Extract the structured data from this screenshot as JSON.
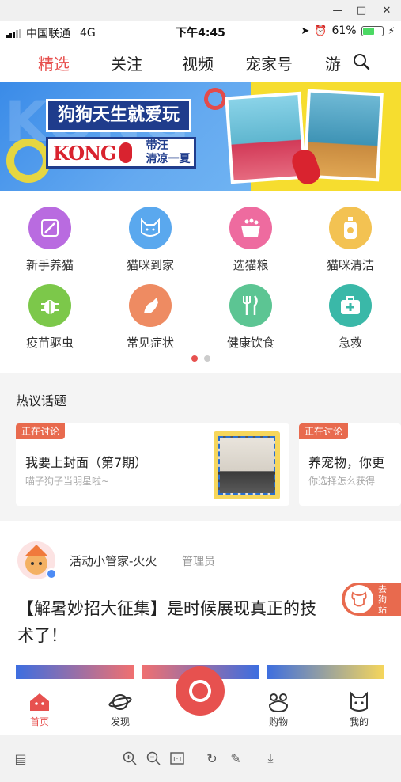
{
  "status": {
    "carrier": "中国联通",
    "network": "4G",
    "time": "下午4:45",
    "battery": "61%"
  },
  "nav": {
    "tabs": [
      "精选",
      "关注",
      "视频",
      "宠家号",
      "游"
    ],
    "active_index": 0
  },
  "banner": {
    "headline": "狗狗天生就爱玩",
    "brand": "KONG",
    "slogan_1": "带汪",
    "slogan_2": "清凉一夏",
    "bg_text": "KONG"
  },
  "categories": [
    {
      "label": "新手养猫",
      "icon": "pencil-icon",
      "color": "#b96be0"
    },
    {
      "label": "猫咪到家",
      "icon": "cat-face-icon",
      "color": "#5aa8ee"
    },
    {
      "label": "选猫粮",
      "icon": "cat-food-icon",
      "color": "#ee6b9f"
    },
    {
      "label": "猫咪清洁",
      "icon": "shampoo-icon",
      "color": "#f3c252"
    },
    {
      "label": "疫苗驱虫",
      "icon": "bug-icon",
      "color": "#7cc84a"
    },
    {
      "label": "常见症状",
      "icon": "cat-cone-icon",
      "color": "#ee8b62"
    },
    {
      "label": "健康饮食",
      "icon": "cutlery-icon",
      "color": "#5cc593"
    },
    {
      "label": "急救",
      "icon": "first-aid-icon",
      "color": "#3ab8a8"
    }
  ],
  "hot": {
    "title": "热议话题",
    "cards": [
      {
        "tag": "正在讨论",
        "title": "我要上封面（第7期）",
        "subtitle": "喵子狗子当明星啦~"
      },
      {
        "tag": "正在讨论",
        "title": "养宠物，你更",
        "subtitle": "你选择怎么获得"
      }
    ]
  },
  "post": {
    "author": "活动小管家-火火",
    "role": "管理员",
    "title": "【解暑妙招大征集】是时候展现真正的技术了！"
  },
  "float_button": {
    "label": "去狗站"
  },
  "tabbar": {
    "items": [
      "首页",
      "发现",
      "购物",
      "我的"
    ],
    "active_index": 0
  },
  "colors": {
    "accent": "#e7514f",
    "tag": "#e86a4e"
  }
}
